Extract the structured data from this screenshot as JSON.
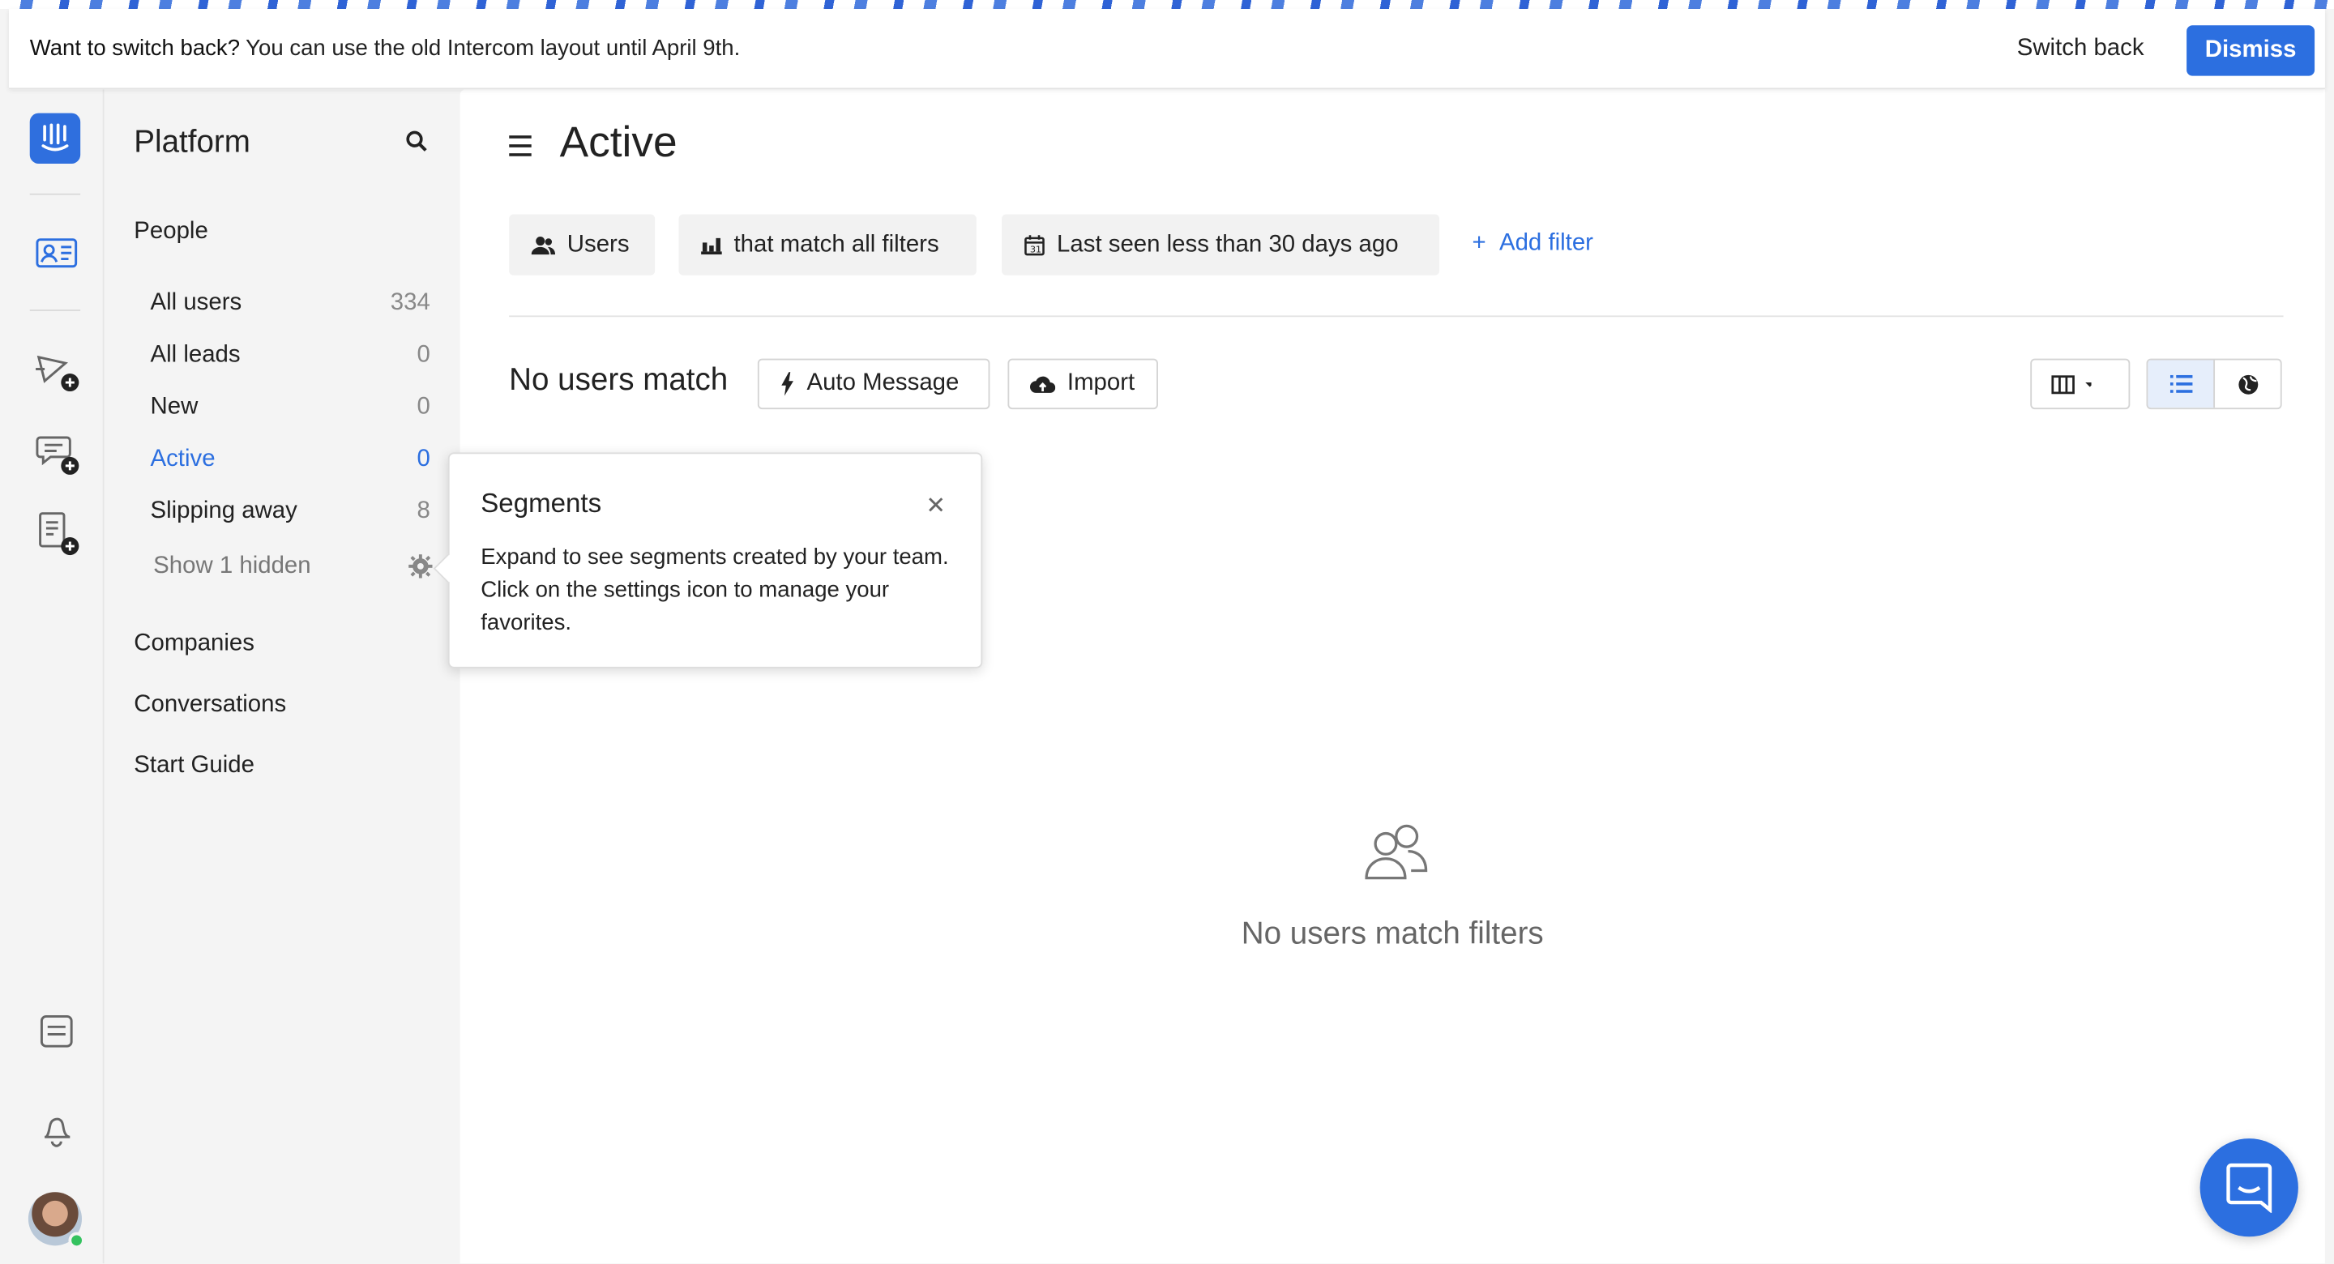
{
  "banner": {
    "message_bold": "Want to switch back?",
    "message_rest": " You can use the old Intercom layout until April 9th.",
    "switch_back": "Switch back",
    "dismiss": "Dismiss",
    "accent": "#2c6fe0"
  },
  "rail": {
    "icons": [
      "intercom-logo-icon",
      "people-icon",
      "outbound-add-icon",
      "chat-add-icon",
      "article-add-icon",
      "inbox-icon",
      "notification-bell-icon",
      "user-avatar"
    ]
  },
  "nav": {
    "title": "Platform",
    "people_heading": "People",
    "items": [
      {
        "label": "All users",
        "count": "334"
      },
      {
        "label": "All leads",
        "count": "0"
      },
      {
        "label": "New",
        "count": "0"
      },
      {
        "label": "Active",
        "count": "0"
      },
      {
        "label": "Slipping away",
        "count": "8"
      }
    ],
    "show_hidden": "Show 1 hidden",
    "companies": "Companies",
    "conversations": "Conversations",
    "start_guide": "Start Guide"
  },
  "main": {
    "title": "Active",
    "filters": {
      "users": "Users",
      "match": "that match all filters",
      "last_seen": "Last seen less than 30 days ago",
      "add_filter": "Add filter"
    },
    "results_heading": "No users match",
    "auto_message": "Auto Message",
    "import": "Import",
    "empty_text": "No users match filters"
  },
  "popover": {
    "title": "Segments",
    "body": "Expand to see segments created by your team. Click on the settings icon to manage your favorites."
  }
}
